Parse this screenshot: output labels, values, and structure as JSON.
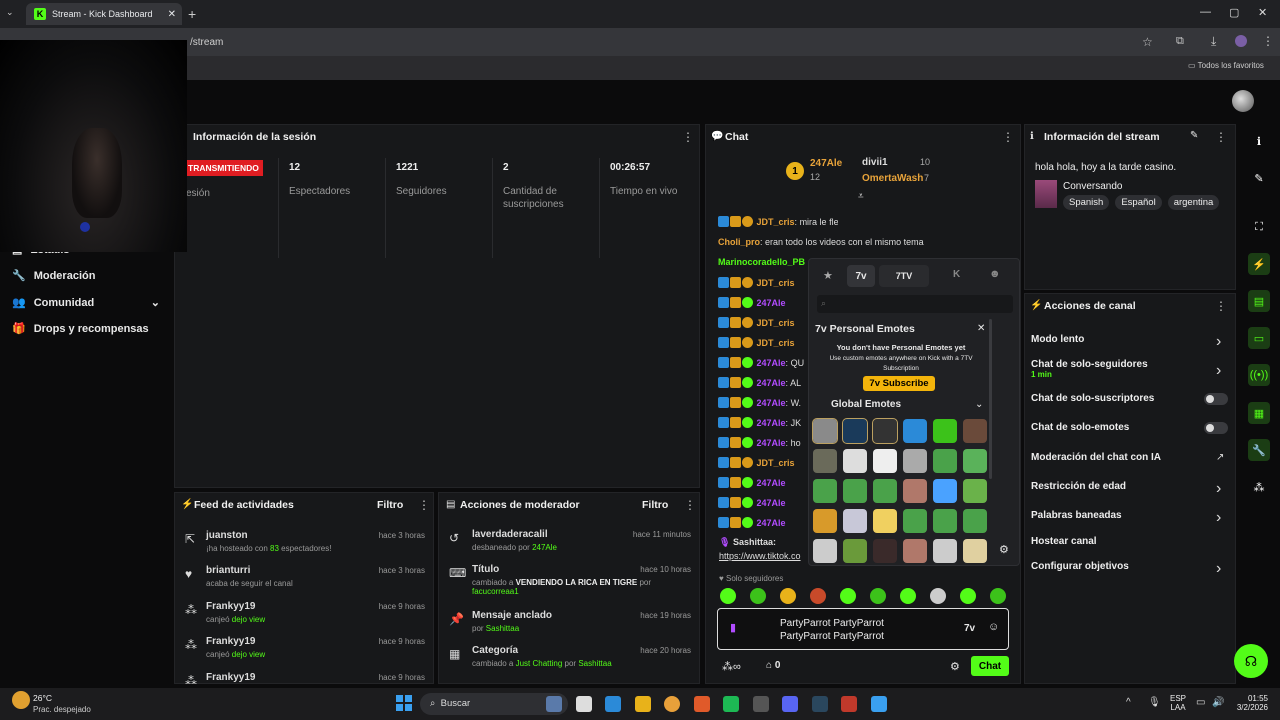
{
  "browser": {
    "tab_title": "Stream - Kick Dashboard",
    "url": "/stream",
    "favorites": "Todos los favoritos"
  },
  "sidebar": {
    "items": [
      {
        "label": "Estadís",
        "icon": "chart-icon"
      },
      {
        "label": "Moderación",
        "icon": "wrench-icon"
      },
      {
        "label": "Comunidad",
        "icon": "people-icon"
      },
      {
        "label": "Drops y recompensas",
        "icon": "gift-icon"
      }
    ]
  },
  "session": {
    "title": "Información de la sesión",
    "live_badge": "TRANSMITIENDO",
    "session_label": "esión",
    "stats": [
      {
        "value": "12",
        "label": "Espectadores"
      },
      {
        "value": "1221",
        "label": "Seguidores"
      },
      {
        "value": "2",
        "label": "Cantidad de suscripciones"
      },
      {
        "value": "00:26:57",
        "label": "Tiempo en vivo"
      }
    ]
  },
  "feed": {
    "title": "Feed de actividades",
    "filter": "Filtro",
    "items": [
      {
        "user": "juanston",
        "pre": "¡ha hosteado con ",
        "hl": "83",
        "post": " espectadores!",
        "time": "hace 3 horas",
        "icon": "host-icon"
      },
      {
        "user": "brianturri",
        "pre": "acaba de seguir el canal",
        "hl": "",
        "post": "",
        "time": "hace 3 horas",
        "icon": "heart-icon"
      },
      {
        "user": "Frankyy19",
        "pre": "canjeó ",
        "hl": "dejo view",
        "post": "",
        "time": "hace 9 horas",
        "icon": "points-icon"
      },
      {
        "user": "Frankyy19",
        "pre": "canjeó ",
        "hl": "dejo view",
        "post": "",
        "time": "hace 9 horas",
        "icon": "points-icon"
      },
      {
        "user": "Frankyy19",
        "pre": "",
        "hl": "",
        "post": "",
        "time": "hace 9 horas",
        "icon": "points-icon"
      }
    ]
  },
  "mod": {
    "title": "Acciones de moderador",
    "filter": "Filtro",
    "items": [
      {
        "title": "laverdaderacalil",
        "pre": "desbaneado por ",
        "hl": "247Ale",
        "post": "",
        "time": "hace 11 minutos",
        "icon": "unban-icon"
      },
      {
        "title": "Título",
        "pre": "cambiado a ",
        "hl": "VENDIENDO LA RICA EN TIGRE",
        "post": " por",
        "extra": "facucorreaa1",
        "time": "hace 10 horas",
        "icon": "title-icon"
      },
      {
        "title": "Mensaje anclado",
        "pre": "por ",
        "hl": "Sashittaa",
        "post": "",
        "time": "hace 19 horas",
        "icon": "pin-icon"
      },
      {
        "title": "Categoría",
        "pre": "cambiado a ",
        "hl": "Just Chatting",
        "post": " por ",
        "extra": "Sashittaa",
        "time": "hace 20 horas",
        "icon": "category-icon"
      }
    ]
  },
  "chat": {
    "title": "Chat",
    "top": {
      "rank": "1",
      "user1": "247Ale",
      "user1_count": "12",
      "user2": "divii1",
      "user2_count": "10",
      "user3": "OmertaWash",
      "user3_count": "7"
    },
    "messages": [
      {
        "user": "JDT_cris",
        "text": "mira le flexion",
        "color": "#e8a33a"
      },
      {
        "user": "Choli_pro",
        "text": "eran todo los videos con el mismo tema",
        "color": "#e8a33a"
      },
      {
        "user": "Marinocoradello_PB",
        "text": "",
        "color": "#53fc18"
      },
      {
        "user": "JDT_cris",
        "text": "",
        "color": "#e8a33a"
      },
      {
        "user": "247Ale",
        "text": "",
        "color": "#b14cff"
      },
      {
        "user": "JDT_cris",
        "text": "",
        "color": "#e8a33a"
      },
      {
        "user": "JDT_cris",
        "text": "",
        "color": "#e8a33a"
      },
      {
        "user": "247Ale",
        "text": "QU",
        "color": "#b14cff"
      },
      {
        "user": "247Ale",
        "text": "AL",
        "color": "#b14cff"
      },
      {
        "user": "247Ale",
        "text": "W.",
        "color": "#b14cff"
      },
      {
        "user": "247Ale",
        "text": "JK",
        "color": "#b14cff"
      },
      {
        "user": "247Ale",
        "text": "ho",
        "color": "#b14cff"
      },
      {
        "user": "JDT_cris",
        "text": "",
        "color": "#e8a33a"
      },
      {
        "user": "247Ale",
        "text": "",
        "color": "#b14cff"
      },
      {
        "user": "247Ale",
        "text": "",
        "color": "#b14cff"
      },
      {
        "user": "247Ale",
        "text": "",
        "color": "#b14cff"
      }
    ],
    "last_user": "Sashittaa:",
    "last_link": "https://www.tiktok.co",
    "followers_only": "Solo seguidores",
    "input_text": "PartyParrot PartyParrot PartyParrot PartyParrot",
    "points": "0",
    "send_label": "Chat"
  },
  "picker": {
    "tab_label": "7TV",
    "personal_title": "Personal Emotes",
    "no_emotes": "You don't have Personal Emotes yet",
    "desc": "Use custom emotes anywhere on Kick with a 7TV Subscription",
    "subscribe": "Subscribe",
    "global_title": "Global Emotes"
  },
  "stream_info": {
    "title": "Información del stream",
    "stream_title": "hola hola, hoy a la tarde casino.",
    "category": "Conversando",
    "tags": [
      "Spanish",
      "Español",
      "argentina"
    ]
  },
  "channel_actions": {
    "title": "Acciones de canal",
    "items": [
      {
        "label": "Modo lento",
        "sub": "",
        "control": "chevron"
      },
      {
        "label": "Chat de solo-seguidores",
        "sub": "1 min",
        "control": "chevron"
      },
      {
        "label": "Chat de solo-suscriptores",
        "sub": "",
        "control": "toggle"
      },
      {
        "label": "Chat de solo-emotes",
        "sub": "",
        "control": "toggle"
      },
      {
        "label": "Moderación del chat con IA",
        "sub": "",
        "control": "external"
      },
      {
        "label": "Restricción de edad",
        "sub": "",
        "control": "chevron"
      },
      {
        "label": "Palabras baneadas",
        "sub": "",
        "control": "chevron"
      },
      {
        "label": "Hostear canal",
        "sub": "",
        "control": "none"
      },
      {
        "label": "Configurar objetivos",
        "sub": "",
        "control": "chevron"
      }
    ]
  },
  "taskbar": {
    "weather_temp": "26°C",
    "weather_desc": "Prac. despejado",
    "search": "Buscar",
    "lang1": "ESP",
    "lang2": "LAA",
    "time": "01:55",
    "date": "3/2/2026"
  },
  "colors": {
    "brand": "#53fc18",
    "live": "#e01d22",
    "panel": "#17181a"
  }
}
